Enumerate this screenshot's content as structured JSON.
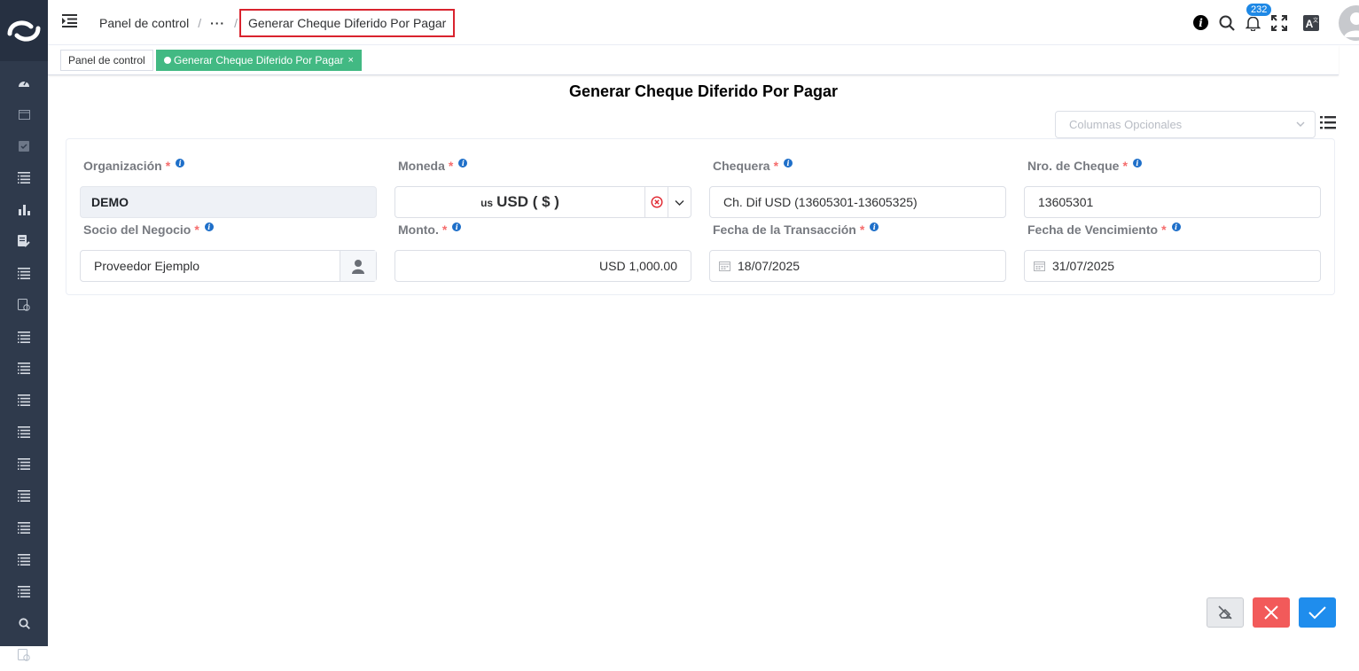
{
  "breadcrumb": {
    "home": "Panel de control",
    "separator": "/",
    "dots": "···",
    "current": "Generar Cheque Diferido Por Pagar"
  },
  "header": {
    "notification_count": "232",
    "icons": [
      "info-icon",
      "search-icon",
      "bell-icon",
      "fullscreen-icon",
      "translate-icon",
      "avatar"
    ]
  },
  "tags": {
    "home": "Panel de control",
    "active": "Generar Cheque Diferido Por Pagar",
    "close": "×"
  },
  "page": {
    "title": "Generar Cheque Diferido Por Pagar",
    "optional_columns_placeholder": "Columnas Opcionales"
  },
  "form": {
    "organization": {
      "label": "Organización",
      "value": "DEMO"
    },
    "currency": {
      "label": "Moneda",
      "symbol": "us",
      "value": "USD ( $ )"
    },
    "checkbook": {
      "label": "Chequera",
      "value": "Ch. Dif USD (13605301-13605325)"
    },
    "check_number": {
      "label": "Nro. de Cheque",
      "value": "13605301"
    },
    "partner": {
      "label": "Socio del Negocio",
      "value": "Proveedor Ejemplo"
    },
    "amount": {
      "label": "Monto.",
      "value": "USD 1,000.00"
    },
    "transaction_date": {
      "label": "Fecha de la Transacción",
      "value": "18/07/2025"
    },
    "due_date": {
      "label": "Fecha de Vencimiento",
      "value": "31/07/2025"
    },
    "required_mark": "*",
    "info_mark": "i"
  },
  "colors": {
    "sidebar": "#2f3a4c",
    "active_tag": "#42b983",
    "highlight_border": "#d9232e",
    "cancel": "#f25a5a",
    "confirm": "#1f8ded"
  }
}
